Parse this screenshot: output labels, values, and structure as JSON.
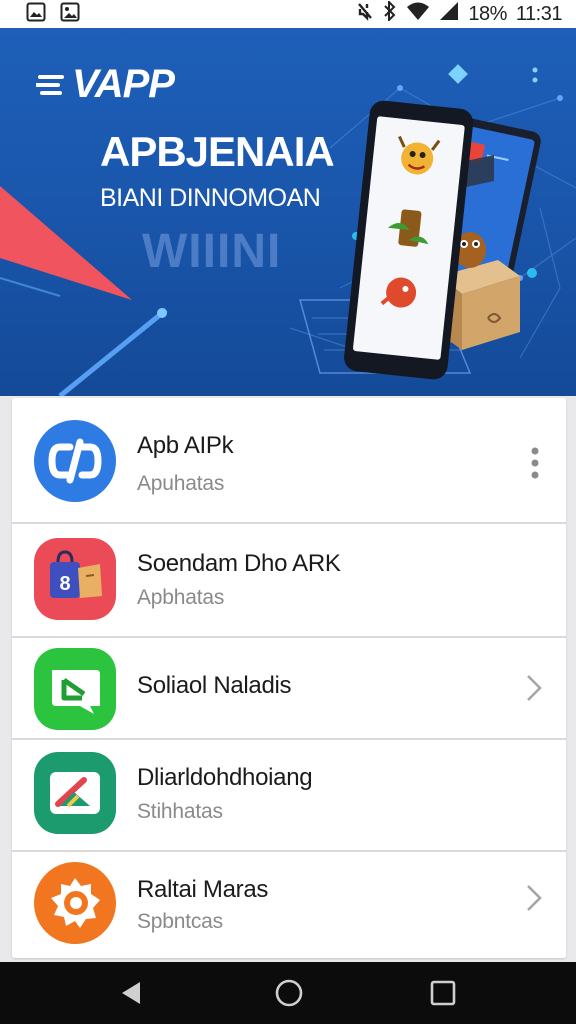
{
  "status_bar": {
    "battery": "18%",
    "time": "11:31",
    "icons": [
      "image-icon",
      "gallery-icon",
      "mute-icon",
      "bluetooth-icon",
      "wifi-icon",
      "signal-icon"
    ]
  },
  "banner": {
    "brand": "VAPP",
    "headline": "APBJENAIA",
    "subheadline": "BIANI DINNOMOAN",
    "ghost_text": "WIIINI"
  },
  "apps": [
    {
      "title": "Apb AIPk",
      "subtitle": "Apuhatas",
      "icon": "link-app-icon",
      "trailing": "more-vert-icon"
    },
    {
      "title": "Soendam Dho ARK",
      "subtitle": "Apbhatas",
      "icon": "store-bag-app-icon",
      "trailing": ""
    },
    {
      "title": "Soliaol Naladis",
      "subtitle": "",
      "icon": "chat-app-icon",
      "trailing": "chevron-right-icon"
    },
    {
      "title": "Dliarldohdhoiang",
      "subtitle": "Stihhatas",
      "icon": "pencil-app-icon",
      "trailing": ""
    },
    {
      "title": "Raltai Maras",
      "subtitle": "Spbntcas",
      "icon": "badge-app-icon",
      "trailing": "chevron-right-icon"
    }
  ],
  "nav_bar": {
    "buttons": [
      "back-icon",
      "home-icon",
      "recents-icon"
    ]
  },
  "colors": {
    "banner_blue": "#1a57ad",
    "accent_red": "#f0555f",
    "link_icon_blue": "#2d7be3",
    "chat_icon_green": "#2cc43f",
    "pencil_icon_teal": "#1c9b6f",
    "badge_icon_orange": "#f2761f"
  }
}
